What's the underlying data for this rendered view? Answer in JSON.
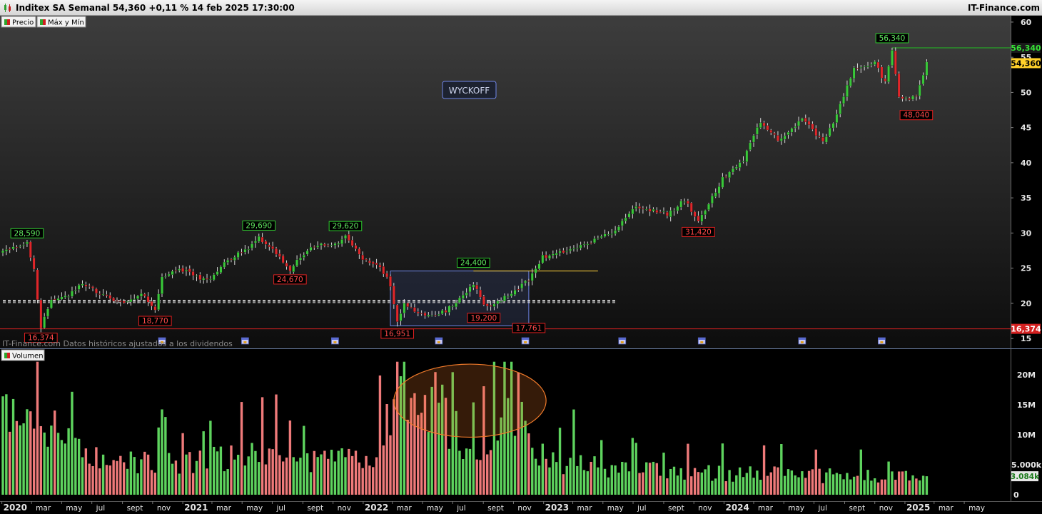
{
  "header": {
    "title": "Inditex SA Semanal 54,360 +0,11 % 14 feb 2025 17:30:00",
    "brand": "IT-Finance.com"
  },
  "legend": {
    "price": "Precio",
    "maxmin": "Máx y Mín",
    "volume": "Volumen"
  },
  "notes": {
    "source": "IT-Finance.com  Datos históricos ajustados a los dividendos",
    "annotation": "WYCKOFF"
  },
  "colors": {
    "up": "#39c939",
    "down": "#e0262a",
    "volume_up": "#5ed35e",
    "volume_down": "#ef7a7a",
    "ellipse": "#f07a2a",
    "box": "#6f86e8",
    "resistance": "#ffd23a",
    "support": "#d42020",
    "high_line": "#22c022"
  },
  "chart_data": {
    "type": "candlestick",
    "price_axis": {
      "ticks": [
        "15",
        "20",
        "25",
        "30",
        "35",
        "40",
        "45",
        "50",
        "55",
        "60"
      ],
      "ylim": [
        14,
        60.5
      ]
    },
    "volume_axis": {
      "ticks": [
        "5.000k",
        "10M",
        "15M",
        "20M"
      ],
      "zero": "0",
      "ylim": [
        0,
        23
      ]
    },
    "time_axis": {
      "start": "2020-01-03",
      "end": "2025-06-06",
      "labels": [
        {
          "date": "2020-01-01",
          "text": "2020",
          "bold": true
        },
        {
          "date": "2020-03-01",
          "text": "mar"
        },
        {
          "date": "2020-05-01",
          "text": "may"
        },
        {
          "date": "2020-07-01",
          "text": "jul"
        },
        {
          "date": "2020-09-01",
          "text": "sept"
        },
        {
          "date": "2020-11-01",
          "text": "nov"
        },
        {
          "date": "2021-01-01",
          "text": "2021",
          "bold": true
        },
        {
          "date": "2021-03-01",
          "text": "mar"
        },
        {
          "date": "2021-05-01",
          "text": "may"
        },
        {
          "date": "2021-07-01",
          "text": "jul"
        },
        {
          "date": "2021-09-01",
          "text": "sept"
        },
        {
          "date": "2021-11-01",
          "text": "nov"
        },
        {
          "date": "2022-01-01",
          "text": "2022",
          "bold": true
        },
        {
          "date": "2022-03-01",
          "text": "mar"
        },
        {
          "date": "2022-05-01",
          "text": "may"
        },
        {
          "date": "2022-07-01",
          "text": "jul"
        },
        {
          "date": "2022-09-01",
          "text": "sept"
        },
        {
          "date": "2022-11-01",
          "text": "nov"
        },
        {
          "date": "2023-01-01",
          "text": "2023",
          "bold": true
        },
        {
          "date": "2023-03-01",
          "text": "mar"
        },
        {
          "date": "2023-05-01",
          "text": "may"
        },
        {
          "date": "2023-07-01",
          "text": "jul"
        },
        {
          "date": "2023-09-01",
          "text": "sept"
        },
        {
          "date": "2023-11-01",
          "text": "nov"
        },
        {
          "date": "2024-01-01",
          "text": "2024",
          "bold": true
        },
        {
          "date": "2024-03-01",
          "text": "mar"
        },
        {
          "date": "2024-05-01",
          "text": "may"
        },
        {
          "date": "2024-07-01",
          "text": "jul"
        },
        {
          "date": "2024-09-01",
          "text": "sept"
        },
        {
          "date": "2024-11-01",
          "text": "nov"
        },
        {
          "date": "2025-01-01",
          "text": "2025",
          "bold": true
        },
        {
          "date": "2025-03-01",
          "text": "mar"
        },
        {
          "date": "2025-05-01",
          "text": "may"
        }
      ]
    },
    "price_path": [
      [
        "2020-01-03",
        27.4
      ],
      [
        "2020-02-21",
        28.5
      ],
      [
        "2020-03-06",
        25.0
      ],
      [
        "2020-03-20",
        16.6
      ],
      [
        "2020-04-10",
        20.5
      ],
      [
        "2020-05-15",
        21.0
      ],
      [
        "2020-06-12",
        22.8
      ],
      [
        "2020-07-31",
        20.8
      ],
      [
        "2020-09-11",
        20.0
      ],
      [
        "2020-10-09",
        21.3
      ],
      [
        "2020-11-06",
        19.3
      ],
      [
        "2020-11-20",
        23.6
      ],
      [
        "2020-12-25",
        24.9
      ],
      [
        "2021-02-19",
        23.2
      ],
      [
        "2021-04-02",
        26.3
      ],
      [
        "2021-05-14",
        27.7
      ],
      [
        "2021-06-04",
        29.4
      ],
      [
        "2021-07-09",
        27.2
      ],
      [
        "2021-08-06",
        24.9
      ],
      [
        "2021-09-10",
        27.6
      ],
      [
        "2021-10-08",
        28.3
      ],
      [
        "2021-11-12",
        28.4
      ],
      [
        "2021-11-26",
        29.4
      ],
      [
        "2021-12-31",
        26.2
      ],
      [
        "2022-02-04",
        25.2
      ],
      [
        "2022-02-25",
        22.6
      ],
      [
        "2022-03-11",
        17.4
      ],
      [
        "2022-03-25",
        19.8
      ],
      [
        "2022-05-06",
        18.2
      ],
      [
        "2022-06-17",
        18.9
      ],
      [
        "2022-07-15",
        20.8
      ],
      [
        "2022-08-12",
        22.8
      ],
      [
        "2022-09-02",
        19.7
      ],
      [
        "2022-09-23",
        19.8
      ],
      [
        "2022-10-28",
        21.5
      ],
      [
        "2022-12-02",
        23.4
      ],
      [
        "2022-12-30",
        26.6
      ],
      [
        "2023-02-24",
        27.5
      ],
      [
        "2023-05-19",
        30.1
      ],
      [
        "2023-07-07",
        33.8
      ],
      [
        "2023-09-08",
        32.7
      ],
      [
        "2023-10-13",
        34.7
      ],
      [
        "2023-11-10",
        31.6
      ],
      [
        "2023-12-29",
        37.8
      ],
      [
        "2024-02-09",
        40.5
      ],
      [
        "2024-03-15",
        45.8
      ],
      [
        "2024-04-19",
        43.2
      ],
      [
        "2024-06-07",
        46.3
      ],
      [
        "2024-07-19",
        42.9
      ],
      [
        "2024-08-09",
        45.7
      ],
      [
        "2024-09-20",
        53.4
      ],
      [
        "2024-11-01",
        54.2
      ],
      [
        "2024-11-22",
        51.4
      ],
      [
        "2024-12-06",
        55.8
      ],
      [
        "2024-12-20",
        49.5
      ],
      [
        "2025-01-10",
        49.2
      ],
      [
        "2025-01-24",
        49.2
      ],
      [
        "2025-02-07",
        52.6
      ],
      [
        "2025-02-14",
        54.36
      ]
    ],
    "volume_path": [
      [
        "2020-01-03",
        15.5
      ],
      [
        "2020-03-20",
        12.0
      ],
      [
        "2020-07-31",
        6.5
      ],
      [
        "2020-12-25",
        6.0
      ],
      [
        "2021-05-14",
        7.5
      ],
      [
        "2021-09-10",
        6.0
      ],
      [
        "2021-12-31",
        6.0
      ],
      [
        "2022-02-25",
        9.5
      ],
      [
        "2022-03-11",
        21.5
      ],
      [
        "2022-04-22",
        18.0
      ],
      [
        "2022-06-03",
        16.5
      ],
      [
        "2022-08-12",
        7.0
      ],
      [
        "2022-10-14",
        13.0
      ],
      [
        "2022-11-04",
        17.5
      ],
      [
        "2022-12-16",
        7.0
      ],
      [
        "2023-06-02",
        4.5
      ],
      [
        "2024-06-07",
        3.5
      ],
      [
        "2025-02-14",
        3.084
      ]
    ],
    "markers": [
      {
        "date": "2020-02-21",
        "price": 28.59,
        "label": "28,590",
        "kind": "high"
      },
      {
        "date": "2020-03-20",
        "price": 16.374,
        "label": "16,374",
        "kind": "low"
      },
      {
        "date": "2020-11-06",
        "price": 18.77,
        "label": "18,770",
        "kind": "low"
      },
      {
        "date": "2021-06-04",
        "price": 29.69,
        "label": "29,690",
        "kind": "high"
      },
      {
        "date": "2021-08-06",
        "price": 24.67,
        "label": "24,670",
        "kind": "low"
      },
      {
        "date": "2021-11-26",
        "price": 29.62,
        "label": "29,620",
        "kind": "high"
      },
      {
        "date": "2022-03-11",
        "price": 16.951,
        "label": "16,951",
        "kind": "low"
      },
      {
        "date": "2022-08-12",
        "price": 24.4,
        "label": "24,400",
        "kind": "high"
      },
      {
        "date": "2022-09-02",
        "price": 19.2,
        "label": "19,200",
        "kind": "low"
      },
      {
        "date": "2022-12-02",
        "price": 17.761,
        "label": "17,761",
        "kind": "low"
      },
      {
        "date": "2023-11-10",
        "price": 31.42,
        "label": "31,420",
        "kind": "low"
      },
      {
        "date": "2024-12-06",
        "price": 56.34,
        "label": "56,340",
        "kind": "high"
      },
      {
        "date": "2025-01-24",
        "price": 48.04,
        "label": "48,040",
        "kind": "low"
      }
    ],
    "levels": [
      {
        "name": "max",
        "price": 56.34,
        "label": "56,340"
      },
      {
        "name": "last",
        "price": 54.36,
        "label": "54,360"
      },
      {
        "name": "min",
        "price": 16.374,
        "label": "16,374"
      }
    ],
    "volume_last_label": "3.084k",
    "wyckoff_range": {
      "start": "2022-02-25",
      "end": "2022-12-02",
      "low": 16.8,
      "high": 24.6
    },
    "resistance_line": {
      "start": "2022-08-12",
      "end": "2023-04-21",
      "price": 24.6
    },
    "dashed_band": {
      "start": "2020-01-03",
      "end": "2023-05-26",
      "prices": [
        20.1,
        20.3,
        20.45
      ]
    },
    "volume_ellipse": {
      "start": "2022-03-04",
      "end": "2023-01-06",
      "top": 21.8,
      "bottom": 9.6
    },
    "event_icons": [
      "2020-11-20",
      "2021-05-07",
      "2021-11-05",
      "2022-06-03",
      "2022-11-25",
      "2023-06-09",
      "2023-11-17",
      "2024-06-07",
      "2024-11-15"
    ]
  }
}
